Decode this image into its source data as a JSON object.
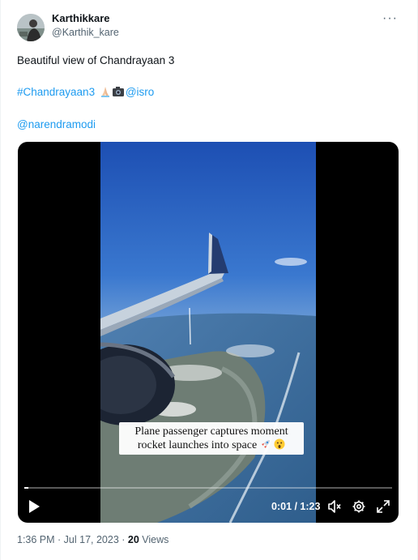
{
  "author": {
    "name": "Karthikkare",
    "handle": "@Karthik_kare",
    "avatar_icon": "avatar-photo"
  },
  "menu_icon": "more-icon",
  "tweet": {
    "text": "Beautiful view of Chandrayaan 3",
    "hashtag": "#Chandrayaan3",
    "mention_isro": "@isro",
    "mention_modi": "@narendramodi",
    "emojis": [
      "folded-hands-icon",
      "camera-icon"
    ]
  },
  "video": {
    "caption_line1": "Plane passenger captures moment",
    "caption_line2": "rocket launches into space",
    "caption_emojis": [
      "rocket-icon",
      "astonished-face-icon"
    ],
    "time_display": "0:01 / 1:23",
    "progress_fraction": 0.012,
    "controls": [
      "play-icon",
      "muted-speaker-icon",
      "settings-icon",
      "fullscreen-icon"
    ]
  },
  "meta": {
    "time": "1:36 PM",
    "separator1": " · ",
    "date": "Jul 17, 2023",
    "separator2": " · ",
    "views_count": "20",
    "views_label": " Views"
  },
  "colors": {
    "link": "#1d9bf0",
    "secondary_text": "#536471"
  }
}
